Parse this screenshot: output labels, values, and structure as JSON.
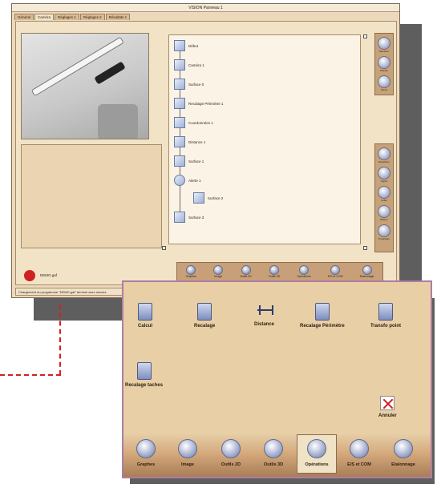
{
  "window": {
    "title": "VISION  Panneau 1",
    "tabs": [
      "Général",
      "Caméra",
      "Réglages 1",
      "Réglages 2",
      "Résultats 1"
    ],
    "file_label": "DEMO.gaf",
    "status": "Chargement du programme \"DEMO.gaf\" terminé avec succès."
  },
  "tree": {
    "nodes": [
      "Début",
      "Caméra 1",
      "Surface 0",
      "Recalage Périmètre 1",
      "Coordonnées 1",
      "Distance 1",
      "Surface 1",
      "Alerte 1",
      "Surface 2",
      "Surface 3"
    ]
  },
  "right_sidebar": {
    "top": [
      "Démarrer",
      "Stopper",
      "Suivre"
    ],
    "bottom": [
      "Désactiver",
      "Copier",
      "Coller",
      "Effacer",
      "Propriétés"
    ]
  },
  "mini_toolbar": [
    "Graphes",
    "Image",
    "Outils 2D",
    "Outils 3D",
    "Opérations",
    "E/S et COM",
    "Etalonnage"
  ],
  "popup": {
    "operations": [
      "Calcul",
      "Recalage",
      "Distance",
      "Recalage Périmètre",
      "Transfo point",
      "Recalage taches"
    ],
    "cancel_label": "Annuler"
  },
  "bottom_toolbar": {
    "buttons": [
      "Graphes",
      "Image",
      "Outils 2D",
      "Outils 3D",
      "Opérations",
      "E/S et COM",
      "Etalonnage"
    ],
    "selected": "Opérations"
  },
  "colors": {
    "window_bg": "#ecd9bc",
    "popup_border": "#b07ca3",
    "connector": "#d42020"
  }
}
